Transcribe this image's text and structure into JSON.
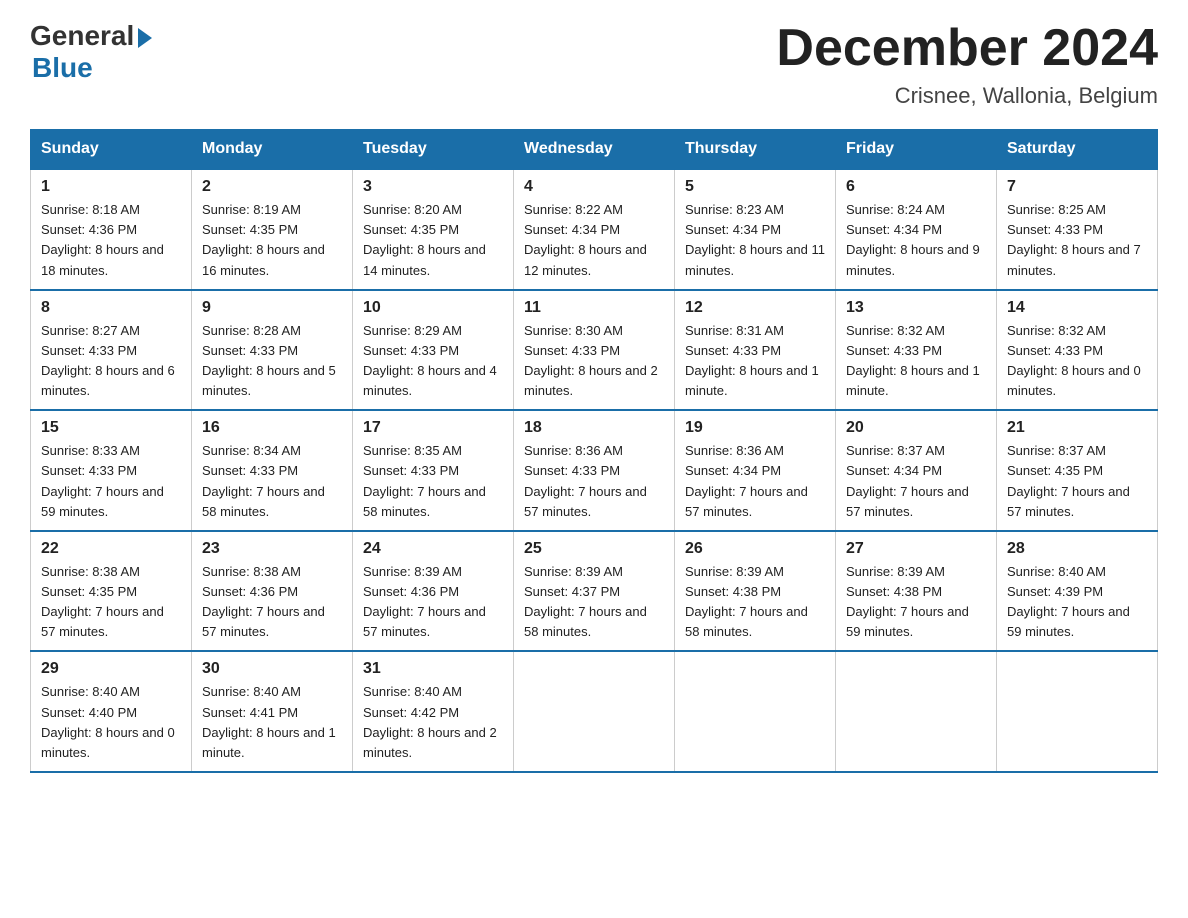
{
  "header": {
    "logo_general": "General",
    "logo_blue": "Blue",
    "month_title": "December 2024",
    "location": "Crisnee, Wallonia, Belgium"
  },
  "days_of_week": [
    "Sunday",
    "Monday",
    "Tuesday",
    "Wednesday",
    "Thursday",
    "Friday",
    "Saturday"
  ],
  "weeks": [
    [
      {
        "day": "1",
        "sunrise": "8:18 AM",
        "sunset": "4:36 PM",
        "daylight": "8 hours and 18 minutes."
      },
      {
        "day": "2",
        "sunrise": "8:19 AM",
        "sunset": "4:35 PM",
        "daylight": "8 hours and 16 minutes."
      },
      {
        "day": "3",
        "sunrise": "8:20 AM",
        "sunset": "4:35 PM",
        "daylight": "8 hours and 14 minutes."
      },
      {
        "day": "4",
        "sunrise": "8:22 AM",
        "sunset": "4:34 PM",
        "daylight": "8 hours and 12 minutes."
      },
      {
        "day": "5",
        "sunrise": "8:23 AM",
        "sunset": "4:34 PM",
        "daylight": "8 hours and 11 minutes."
      },
      {
        "day": "6",
        "sunrise": "8:24 AM",
        "sunset": "4:34 PM",
        "daylight": "8 hours and 9 minutes."
      },
      {
        "day": "7",
        "sunrise": "8:25 AM",
        "sunset": "4:33 PM",
        "daylight": "8 hours and 7 minutes."
      }
    ],
    [
      {
        "day": "8",
        "sunrise": "8:27 AM",
        "sunset": "4:33 PM",
        "daylight": "8 hours and 6 minutes."
      },
      {
        "day": "9",
        "sunrise": "8:28 AM",
        "sunset": "4:33 PM",
        "daylight": "8 hours and 5 minutes."
      },
      {
        "day": "10",
        "sunrise": "8:29 AM",
        "sunset": "4:33 PM",
        "daylight": "8 hours and 4 minutes."
      },
      {
        "day": "11",
        "sunrise": "8:30 AM",
        "sunset": "4:33 PM",
        "daylight": "8 hours and 2 minutes."
      },
      {
        "day": "12",
        "sunrise": "8:31 AM",
        "sunset": "4:33 PM",
        "daylight": "8 hours and 1 minute."
      },
      {
        "day": "13",
        "sunrise": "8:32 AM",
        "sunset": "4:33 PM",
        "daylight": "8 hours and 1 minute."
      },
      {
        "day": "14",
        "sunrise": "8:32 AM",
        "sunset": "4:33 PM",
        "daylight": "8 hours and 0 minutes."
      }
    ],
    [
      {
        "day": "15",
        "sunrise": "8:33 AM",
        "sunset": "4:33 PM",
        "daylight": "7 hours and 59 minutes."
      },
      {
        "day": "16",
        "sunrise": "8:34 AM",
        "sunset": "4:33 PM",
        "daylight": "7 hours and 58 minutes."
      },
      {
        "day": "17",
        "sunrise": "8:35 AM",
        "sunset": "4:33 PM",
        "daylight": "7 hours and 58 minutes."
      },
      {
        "day": "18",
        "sunrise": "8:36 AM",
        "sunset": "4:33 PM",
        "daylight": "7 hours and 57 minutes."
      },
      {
        "day": "19",
        "sunrise": "8:36 AM",
        "sunset": "4:34 PM",
        "daylight": "7 hours and 57 minutes."
      },
      {
        "day": "20",
        "sunrise": "8:37 AM",
        "sunset": "4:34 PM",
        "daylight": "7 hours and 57 minutes."
      },
      {
        "day": "21",
        "sunrise": "8:37 AM",
        "sunset": "4:35 PM",
        "daylight": "7 hours and 57 minutes."
      }
    ],
    [
      {
        "day": "22",
        "sunrise": "8:38 AM",
        "sunset": "4:35 PM",
        "daylight": "7 hours and 57 minutes."
      },
      {
        "day": "23",
        "sunrise": "8:38 AM",
        "sunset": "4:36 PM",
        "daylight": "7 hours and 57 minutes."
      },
      {
        "day": "24",
        "sunrise": "8:39 AM",
        "sunset": "4:36 PM",
        "daylight": "7 hours and 57 minutes."
      },
      {
        "day": "25",
        "sunrise": "8:39 AM",
        "sunset": "4:37 PM",
        "daylight": "7 hours and 58 minutes."
      },
      {
        "day": "26",
        "sunrise": "8:39 AM",
        "sunset": "4:38 PM",
        "daylight": "7 hours and 58 minutes."
      },
      {
        "day": "27",
        "sunrise": "8:39 AM",
        "sunset": "4:38 PM",
        "daylight": "7 hours and 59 minutes."
      },
      {
        "day": "28",
        "sunrise": "8:40 AM",
        "sunset": "4:39 PM",
        "daylight": "7 hours and 59 minutes."
      }
    ],
    [
      {
        "day": "29",
        "sunrise": "8:40 AM",
        "sunset": "4:40 PM",
        "daylight": "8 hours and 0 minutes."
      },
      {
        "day": "30",
        "sunrise": "8:40 AM",
        "sunset": "4:41 PM",
        "daylight": "8 hours and 1 minute."
      },
      {
        "day": "31",
        "sunrise": "8:40 AM",
        "sunset": "4:42 PM",
        "daylight": "8 hours and 2 minutes."
      },
      null,
      null,
      null,
      null
    ]
  ],
  "labels": {
    "sunrise": "Sunrise:",
    "sunset": "Sunset:",
    "daylight": "Daylight:"
  }
}
